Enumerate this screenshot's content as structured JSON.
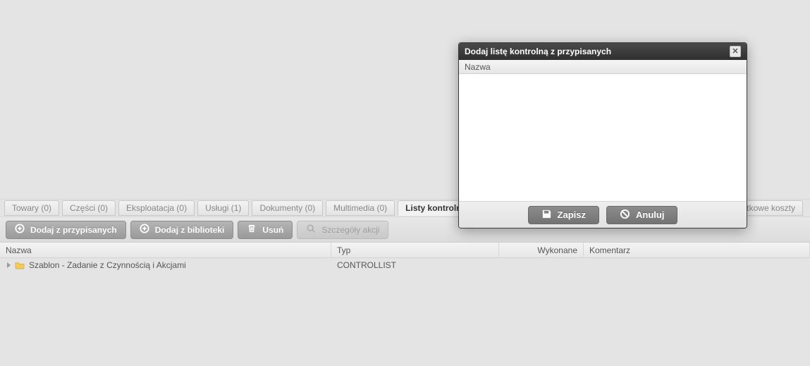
{
  "tabs": {
    "towary": "Towary (0)",
    "czesci": "Części (0)",
    "eksploatacja": "Eksploatacja (0)",
    "uslugi": "Usługi (1)",
    "dokumenty": "Dokumenty (0)",
    "multimedia": "Multimedia (0)",
    "listy_kontrolne": "Listy kontrolne (",
    "dodatkowe_koszty": "Dodatkowe koszty"
  },
  "toolbar": {
    "add_assigned": "Dodaj z przypisanych",
    "add_library": "Dodaj z biblioteki",
    "delete": "Usuń",
    "details": "Szczegóły akcji"
  },
  "columns": {
    "name": "Nazwa",
    "type": "Typ",
    "done": "Wykonane",
    "comment": "Komentarz"
  },
  "rows": [
    {
      "name": "Szablon - Zadanie z Czynnością i Akcjami",
      "type": "CONTROLLIST",
      "done": "",
      "comment": ""
    }
  ],
  "modal": {
    "title": "Dodaj listę kontrolną z przypisanych",
    "col_name": "Nazwa",
    "save": "Zapisz",
    "cancel": "Anuluj"
  }
}
